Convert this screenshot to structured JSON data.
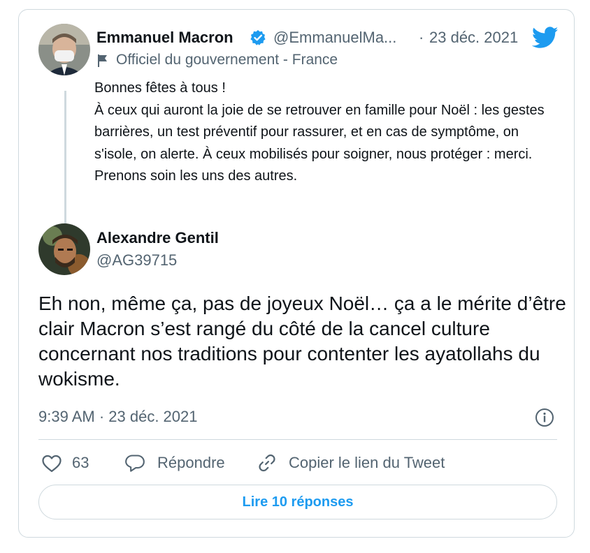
{
  "quoted_tweet": {
    "author_name": "Emmanuel Macron",
    "handle": "@EmmanuelMa...",
    "separator": "·",
    "date": "23 déc. 2021",
    "label": "Officiel du gouvernement - France",
    "text_line_1": "Bonnes fêtes à tous !",
    "text_body": "À ceux qui auront la joie de se retrouver en famille pour Noël : les gestes barrières, un test préventif pour rassurer, et en cas de symptôme, on s'isole, on alerte. À ceux mobilisés pour soigner, nous protéger : merci. Prenons soin les uns des autres."
  },
  "reply_tweet": {
    "author_name": "Alexandre Gentil",
    "handle": "@AG39715",
    "text": "Eh non, même ça, pas de joyeux Noël… ça a le mérite d’être clair Macron s’est rangé du côté de la cancel culture concernant nos traditions pour contenter les ayatollahs du wokisme.",
    "timestamp": "9:39 AM · 23 déc. 2021"
  },
  "actions": {
    "like_count": "63",
    "reply_label": "Répondre",
    "copy_link_label": "Copier le lien du Tweet"
  },
  "read_replies_label": "Lire 10 réponses",
  "colors": {
    "accent": "#1d9bf0",
    "muted": "#536471",
    "border": "#cfd9de"
  },
  "icons": [
    "twitter-bird-icon",
    "verified-badge-icon",
    "flag-icon",
    "info-icon",
    "heart-icon",
    "reply-bubble-icon",
    "link-icon"
  ]
}
